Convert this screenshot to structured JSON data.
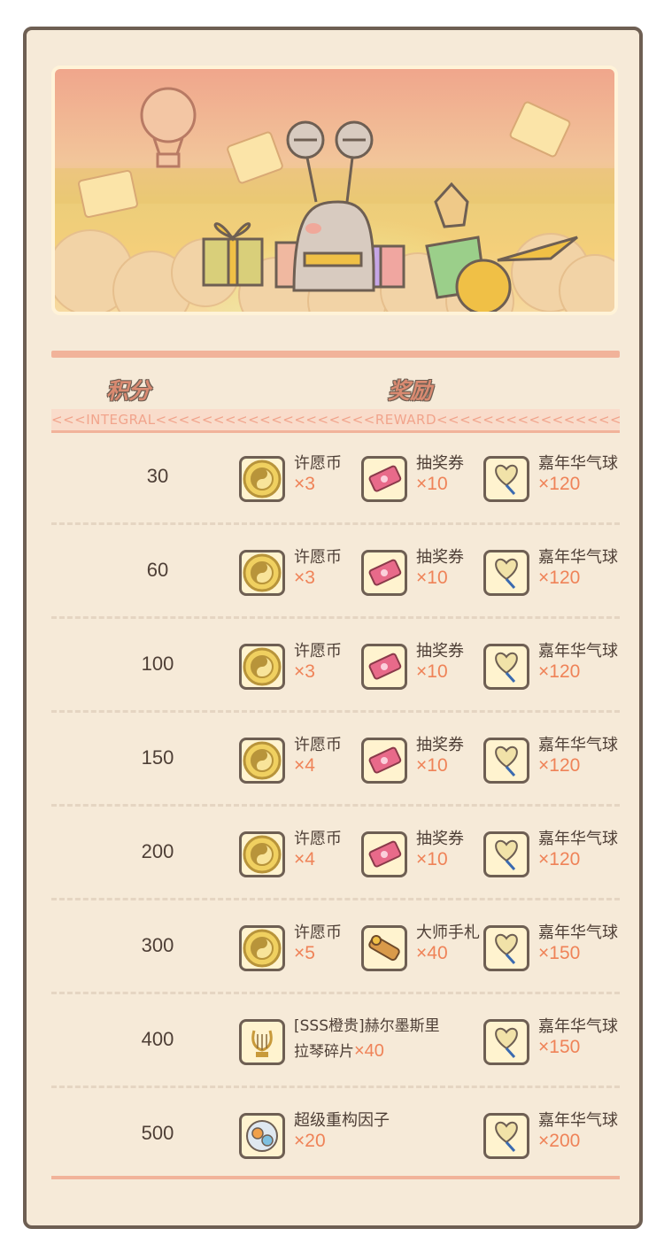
{
  "headers": {
    "score": "积分",
    "reward": "奖励",
    "subtitle": "<<<INTEGRAL<<<<<<<<<<<<<<<<<<<REWARD<<<<<<<<<<<<<<<<"
  },
  "rows": [
    {
      "score": "30",
      "r1": {
        "icon": "wish-coin-icon",
        "name": "许愿币",
        "qty": "×3"
      },
      "r2": {
        "icon": "lottery-ticket-icon",
        "name": "抽奖券",
        "qty": "×10"
      },
      "r3": {
        "icon": "carnival-balloon-icon",
        "name": "嘉年华气球",
        "qty": "×120"
      }
    },
    {
      "score": "60",
      "r1": {
        "icon": "wish-coin-icon",
        "name": "许愿币",
        "qty": "×3"
      },
      "r2": {
        "icon": "lottery-ticket-icon",
        "name": "抽奖券",
        "qty": "×10"
      },
      "r3": {
        "icon": "carnival-balloon-icon",
        "name": "嘉年华气球",
        "qty": "×120"
      }
    },
    {
      "score": "100",
      "r1": {
        "icon": "wish-coin-icon",
        "name": "许愿币",
        "qty": "×3"
      },
      "r2": {
        "icon": "lottery-ticket-icon",
        "name": "抽奖券",
        "qty": "×10"
      },
      "r3": {
        "icon": "carnival-balloon-icon",
        "name": "嘉年华气球",
        "qty": "×120"
      }
    },
    {
      "score": "150",
      "r1": {
        "icon": "wish-coin-icon",
        "name": "许愿币",
        "qty": "×4"
      },
      "r2": {
        "icon": "lottery-ticket-icon",
        "name": "抽奖券",
        "qty": "×10"
      },
      "r3": {
        "icon": "carnival-balloon-icon",
        "name": "嘉年华气球",
        "qty": "×120"
      }
    },
    {
      "score": "200",
      "r1": {
        "icon": "wish-coin-icon",
        "name": "许愿币",
        "qty": "×4"
      },
      "r2": {
        "icon": "lottery-ticket-icon",
        "name": "抽奖券",
        "qty": "×10"
      },
      "r3": {
        "icon": "carnival-balloon-icon",
        "name": "嘉年华气球",
        "qty": "×120"
      }
    },
    {
      "score": "300",
      "r1": {
        "icon": "wish-coin-icon",
        "name": "许愿币",
        "qty": "×5"
      },
      "r2": {
        "icon": "master-notes-icon",
        "name": "大师手札",
        "qty": "×40"
      },
      "r3": {
        "icon": "carnival-balloon-icon",
        "name": "嘉年华气球",
        "qty": "×150"
      }
    },
    {
      "score": "400",
      "r1": {
        "icon": "lyre-fragment-icon",
        "name_line1": "[SSS橙贵]赫尔墨斯里",
        "name_line2": "拉琴碎片",
        "qty": "×40"
      },
      "r3": {
        "icon": "carnival-balloon-icon",
        "name": "嘉年华气球",
        "qty": "×150"
      }
    },
    {
      "score": "500",
      "r1": {
        "icon": "reconstruction-factor-icon",
        "name": "超级重构因子",
        "qty": "×20"
      },
      "r3": {
        "icon": "carnival-balloon-icon",
        "name": "嘉年华气球",
        "qty": "×200"
      }
    }
  ],
  "colors": {
    "accent": "#f1b39a",
    "quantity": "#ef8358",
    "text": "#4e3f36",
    "background": "#f6ead8"
  }
}
